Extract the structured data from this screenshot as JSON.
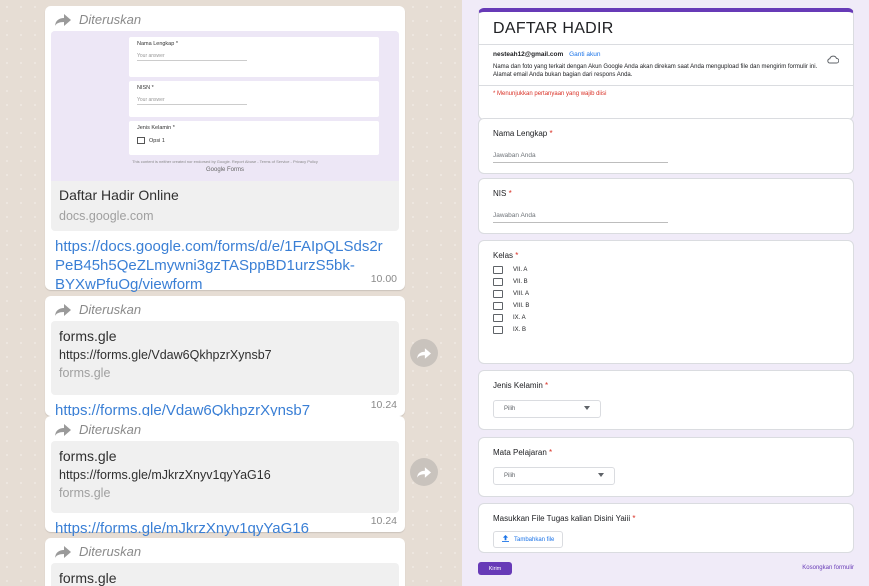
{
  "chat": {
    "forward_label": "Diteruskan",
    "messages": [
      {
        "preview_title": "Daftar Hadir Online",
        "preview_domain": "docs.google.com",
        "url": "https://docs.google.com/forms/d/e/1FAIpQLSds2rPeB45h5QeZLmywni3gzTASppBD1urzS5bk-BYXwPfuOg/viewform",
        "url_lines": [
          "https://docs.google.com/forms/d/e/1FAIpQLSds2r",
          "PeB45h5QeZLmywni3gzTASppBD1urzS5bk-",
          "BYXwPfuOg/viewform"
        ],
        "time": "10.00",
        "thumbnail": {
          "q1": "Nama Lengkap *",
          "q1_answer": "Your answer",
          "q2": "NISN *",
          "q2_answer": "Your answer",
          "q3": "Jenis Kelamin *",
          "q3_option": "Opsi 1",
          "footer": "This content is neither created nor endorsed by Google. Report Abuse - Terms of Service - Privacy Policy",
          "brand": "Google Forms"
        }
      },
      {
        "preview_title": "forms.gle",
        "preview_url": "https://forms.gle/Vdaw6QkhpzrXynsb7",
        "preview_domain": "forms.gle",
        "url": "https://forms.gle/Vdaw6QkhpzrXynsb7",
        "time": "10.24"
      },
      {
        "preview_title": "forms.gle",
        "preview_url": "https://forms.gle/mJkrzXnyv1qyYaG16",
        "preview_domain": "forms.gle",
        "url": "https://forms.gle/mJkrzXnyv1qyYaG16",
        "time": "10.24"
      },
      {
        "preview_title": "forms.gle"
      }
    ]
  },
  "form": {
    "accent": "#673ab7",
    "title": "DAFTAR HADIR",
    "email": "nesteah12@gmail.com",
    "switch_account": "Ganti akun",
    "notice": "Nama dan foto yang terkait dengan Akun Google Anda akan direkam saat Anda mengupload file dan mengirim formulir ini. Alamat email Anda bukan bagian dari respons Anda.",
    "required_note": "* Menunjukkan pertanyaan yang wajib diisi",
    "questions": {
      "nama": {
        "label": "Nama Lengkap",
        "placeholder": "Jawaban Anda"
      },
      "nis": {
        "label": "NIS",
        "placeholder": "Jawaban Anda"
      },
      "kelas": {
        "label": "Kelas",
        "options": [
          "VII. A",
          "VII. B",
          "VIII. A",
          "VIII. B",
          "IX. A",
          "IX. B"
        ]
      },
      "jenis_kelamin": {
        "label": "Jenis Kelamin",
        "select_value": "Pilih"
      },
      "mapel": {
        "label": "Mata Pelajaran",
        "select_value": "Pilih"
      },
      "file": {
        "label": "Masukkan File Tugas kalian Disini Yaiii",
        "button": "Tambahkan file"
      }
    },
    "submit": "Kirim",
    "clear": "Kosongkan formulir"
  }
}
